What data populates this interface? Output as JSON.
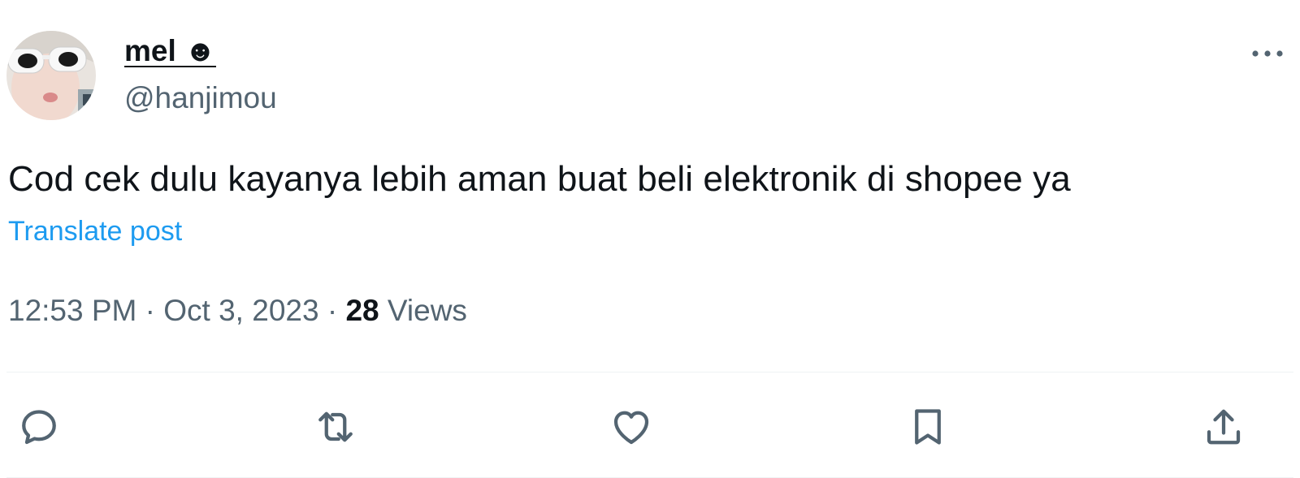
{
  "author": {
    "display_name": "mel ☻",
    "handle": "@hanjimou",
    "avatar_icon": "avatar-photo"
  },
  "post": {
    "text": "Cod cek dulu kayanya lebih aman buat beli elektronik di shopee ya",
    "translate_label": "Translate post",
    "time": "12:53 PM",
    "separator": "·",
    "date": "Oct 3, 2023",
    "views_count": "28",
    "views_label": "Views"
  },
  "actions": {
    "reply_icon": "reply-icon",
    "repost_icon": "repost-icon",
    "like_icon": "heart-icon",
    "bookmark_icon": "bookmark-icon",
    "share_icon": "share-icon"
  },
  "colors": {
    "text_primary": "#0f1419",
    "text_secondary": "#536471",
    "link": "#1d9bf0",
    "divider": "#eff3f4"
  }
}
